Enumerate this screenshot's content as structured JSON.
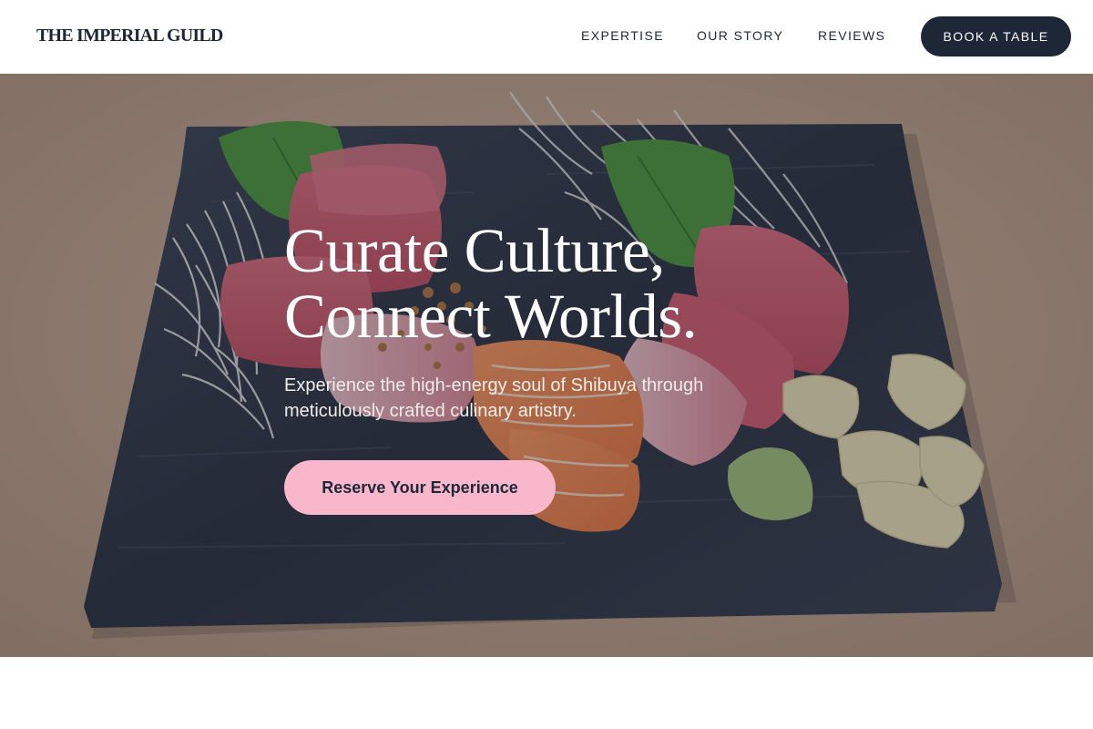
{
  "nav": {
    "brand": "THE IMPERIAL GUILD",
    "links": [
      "EXPERTISE",
      "OUR STORY",
      "REVIEWS"
    ],
    "book_label": "BOOK A TABLE"
  },
  "hero": {
    "headline_line1": "Curate Culture,",
    "headline_line2": "Connect Worlds.",
    "subtitle": "Experience the high-energy soul of Shibuya through meticulously crafted culinary artistry.",
    "cta_label": "Reserve Your Experience",
    "image_subject": "sashimi-platter-photo"
  },
  "colors": {
    "navy": "#1e2738",
    "cta_pink": "#f8b7cb",
    "white": "#ffffff"
  }
}
